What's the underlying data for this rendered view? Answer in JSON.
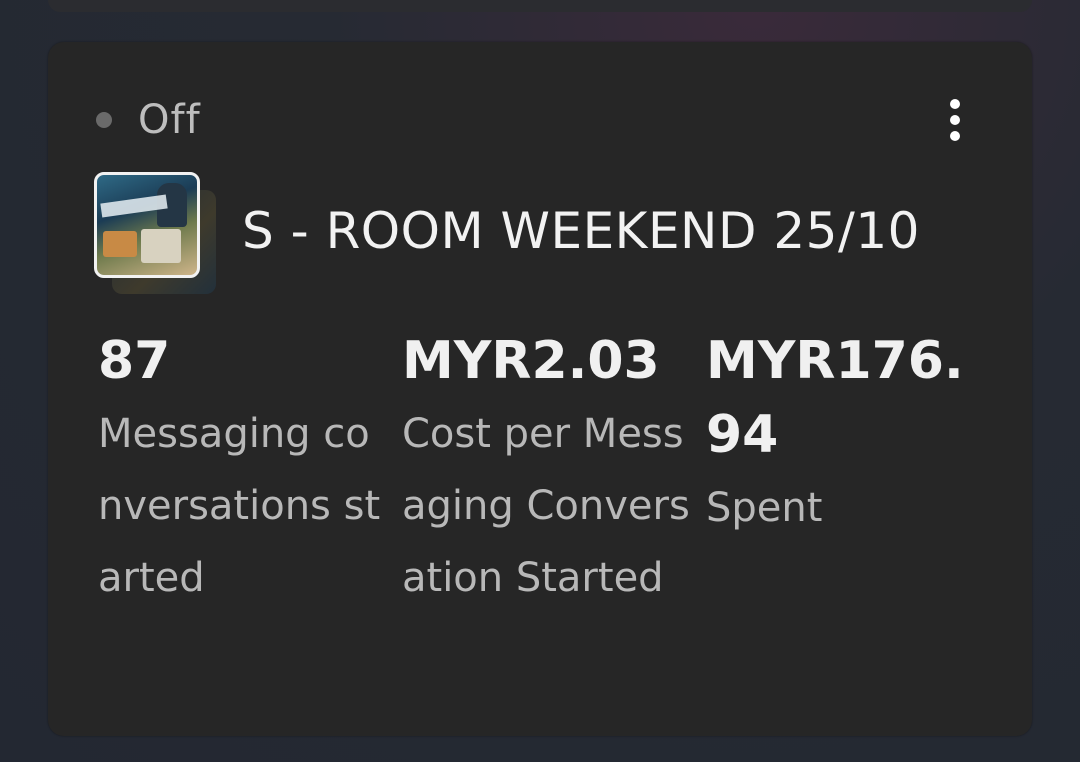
{
  "campaign": {
    "status": "Off",
    "name": "S - ROOM WEEKEND 25/10",
    "thumbnail_icon": "ad-creative-thumbnail",
    "menu_icon": "more-vertical-icon"
  },
  "metrics": [
    {
      "value": "87",
      "label": "Messaging conversations started"
    },
    {
      "value": "MYR2.03",
      "label": "Cost per Messaging Conversation Started"
    },
    {
      "value": "MYR176.94",
      "label": "Spent"
    }
  ],
  "colors": {
    "card_background": "#262626",
    "status_dot": "#6a6a6a",
    "primary_text": "#f0f0f0",
    "secondary_text": "#b8b8b8"
  }
}
